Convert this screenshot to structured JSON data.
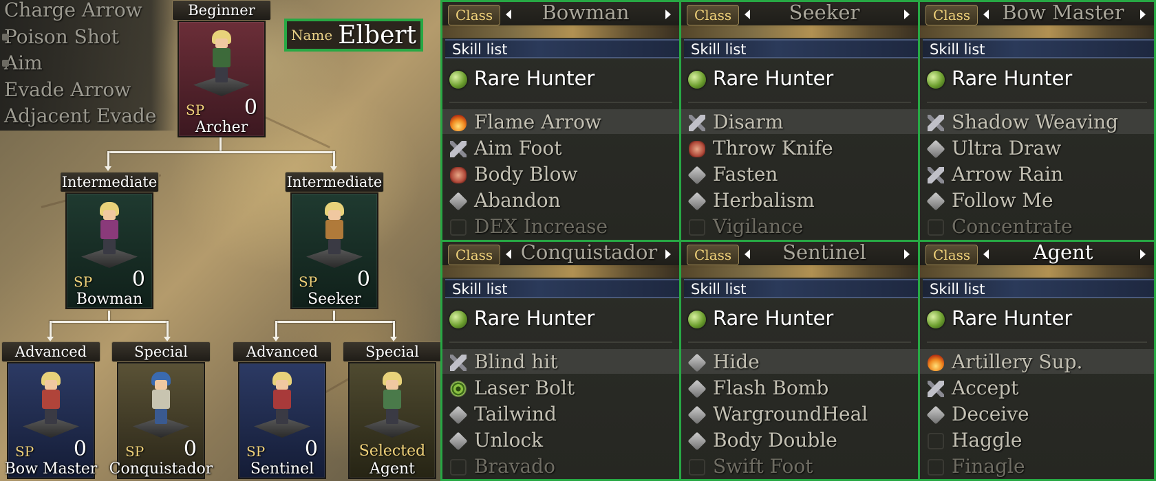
{
  "character": {
    "name_label": "Name",
    "name": "Elbert"
  },
  "learned_skills": [
    "Charge Arrow",
    "Poison Shot",
    "Aim",
    "Evade Arrow",
    "Adjacent Evade"
  ],
  "sp_label": "SP",
  "tree": {
    "archer": {
      "tier": "Beginner",
      "name": "Archer",
      "sp": "0"
    },
    "bowman": {
      "tier": "Intermediate",
      "name": "Bowman",
      "sp": "0"
    },
    "seeker": {
      "tier": "Intermediate",
      "name": "Seeker",
      "sp": "0"
    },
    "bow_master": {
      "tier": "Advanced",
      "name": "Bow Master",
      "sp": "0"
    },
    "conquistador": {
      "tier": "Special",
      "name": "Conquistador",
      "sp": "0"
    },
    "sentinel": {
      "tier": "Advanced",
      "name": "Sentinel",
      "sp": "0"
    },
    "agent": {
      "tier": "Special",
      "name": "Agent",
      "status": "Selected"
    }
  },
  "panels": [
    {
      "class_label": "Class",
      "class_name": "Bowman",
      "skill_list_label": "Skill list",
      "rare": "Rare Hunter",
      "skills": [
        {
          "icon": "flame-icon",
          "name": "Flame Arrow"
        },
        {
          "icon": "sword-icon",
          "name": "Aim Foot"
        },
        {
          "icon": "fist-icon",
          "name": "Body Blow"
        },
        {
          "icon": "cube-icon",
          "name": "Abandon"
        },
        {
          "icon": "blank-icon",
          "name": "DEX Increase"
        }
      ]
    },
    {
      "class_label": "Class",
      "class_name": "Seeker",
      "skill_list_label": "Skill list",
      "rare": "Rare Hunter",
      "skills": [
        {
          "icon": "sword-icon",
          "name": "Disarm"
        },
        {
          "icon": "fist-icon",
          "name": "Throw Knife"
        },
        {
          "icon": "cube-icon",
          "name": "Fasten"
        },
        {
          "icon": "cube-icon",
          "name": "Herbalism"
        },
        {
          "icon": "blank-icon",
          "name": "Vigilance"
        }
      ]
    },
    {
      "class_label": "Class",
      "class_name": "Bow Master",
      "skill_list_label": "Skill list",
      "rare": "Rare Hunter",
      "skills": [
        {
          "icon": "sword-icon",
          "name": "Shadow Weaving"
        },
        {
          "icon": "cube-icon",
          "name": "Ultra Draw"
        },
        {
          "icon": "sword-icon",
          "name": "Arrow Rain"
        },
        {
          "icon": "cube-icon",
          "name": "Follow Me"
        },
        {
          "icon": "blank-icon",
          "name": "Concentrate"
        }
      ]
    },
    {
      "class_label": "Class",
      "class_name": "Conquistador",
      "skill_list_label": "Skill list",
      "rare": "Rare Hunter",
      "skills": [
        {
          "icon": "sword-icon",
          "name": "Blind hit"
        },
        {
          "icon": "swirl-icon",
          "name": "Laser Bolt"
        },
        {
          "icon": "cube-icon",
          "name": "Tailwind"
        },
        {
          "icon": "cube-icon",
          "name": "Unlock"
        },
        {
          "icon": "blank-icon",
          "name": "Bravado"
        }
      ]
    },
    {
      "class_label": "Class",
      "class_name": "Sentinel",
      "skill_list_label": "Skill list",
      "rare": "Rare Hunter",
      "skills": [
        {
          "icon": "cube-icon",
          "name": "Hide"
        },
        {
          "icon": "cube-icon",
          "name": "Flash Bomb"
        },
        {
          "icon": "cube-icon",
          "name": "WargroundHeal"
        },
        {
          "icon": "cube-icon",
          "name": "Body Double"
        },
        {
          "icon": "blank-icon",
          "name": "Swift Foot"
        }
      ]
    },
    {
      "class_label": "Class",
      "class_name": "Agent",
      "skill_list_label": "Skill list",
      "rare": "Rare Hunter",
      "skills": [
        {
          "icon": "flame-icon",
          "name": "Artillery Sup."
        },
        {
          "icon": "sword-icon",
          "name": "Accept"
        },
        {
          "icon": "cube-icon",
          "name": "Deceive"
        },
        {
          "icon": "blank-icon",
          "name": "Haggle"
        },
        {
          "icon": "blank-icon",
          "name": "Finagle"
        }
      ]
    }
  ]
}
